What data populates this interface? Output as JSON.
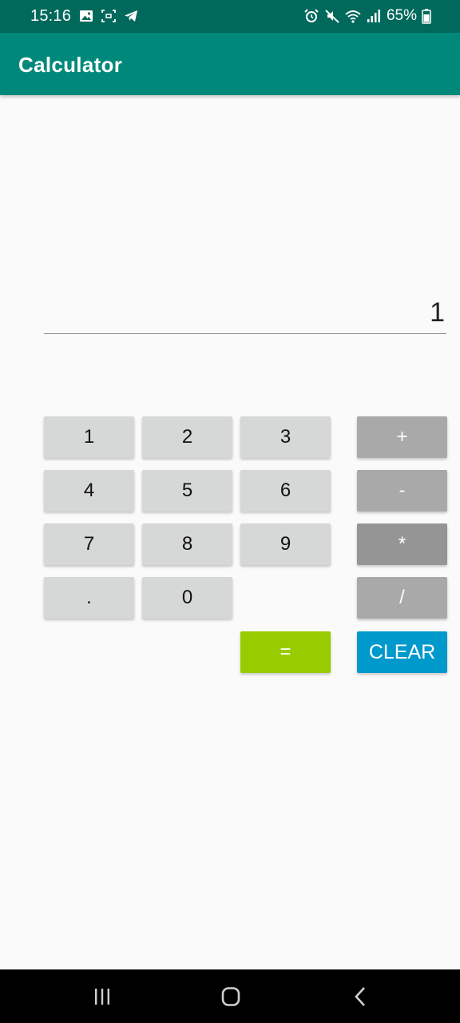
{
  "status_bar": {
    "time": "15:16",
    "battery": "65%",
    "left_icons": [
      "image-icon",
      "screenshot-icon",
      "telegram-icon"
    ],
    "right_icons": [
      "alarm-icon",
      "mute-icon",
      "wifi-icon",
      "signal-icon",
      "battery-icon"
    ]
  },
  "app_bar": {
    "title": "Calculator"
  },
  "display": {
    "value": "1"
  },
  "keypad": {
    "k1": "1",
    "k2": "2",
    "k3": "3",
    "k4": "4",
    "k5": "5",
    "k6": "6",
    "k7": "7",
    "k8": "8",
    "k9": "9",
    "dot": ".",
    "k0": "0",
    "plus": "+",
    "minus": "-",
    "multiply": "*",
    "divide": "/",
    "equals": "=",
    "clear": "CLEAR"
  },
  "colors": {
    "status_bar": "#00695c",
    "app_bar": "#00897b",
    "number_key": "#d6d7d7",
    "operator_key": "#a9a9a9",
    "equals_key": "#99cc00",
    "clear_key": "#0099cc"
  },
  "nav_bar": {
    "icons": [
      "recents-icon",
      "home-icon",
      "back-icon"
    ]
  }
}
